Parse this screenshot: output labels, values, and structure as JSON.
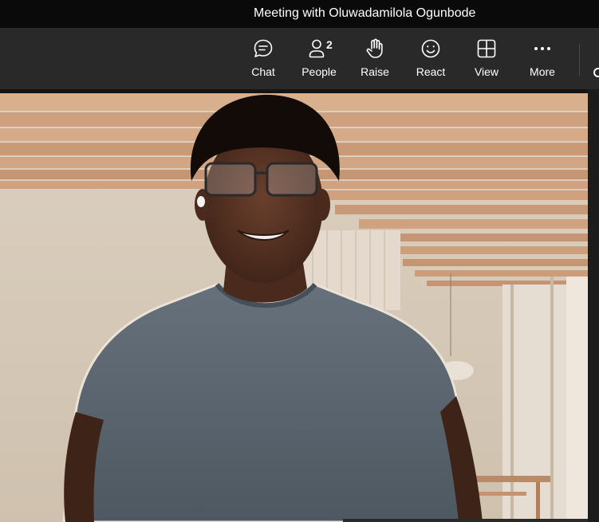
{
  "window": {
    "title": "Meeting with Oluwadamilola Ogunbode"
  },
  "toolbar": {
    "items": [
      {
        "label": "Chat",
        "icon": "chat-icon"
      },
      {
        "label": "People",
        "icon": "people-icon",
        "badge": "2"
      },
      {
        "label": "Raise",
        "icon": "raise-hand-icon"
      },
      {
        "label": "React",
        "icon": "react-emoji-icon"
      },
      {
        "label": "View",
        "icon": "view-grid-icon"
      },
      {
        "label": "More",
        "icon": "more-dots-icon"
      }
    ]
  },
  "colors": {
    "title_bar": "#0a0a0a",
    "toolbar": "#292929",
    "text": "#ffffff",
    "shirt": "#5b6670",
    "ceiling_wood": "#d2a785",
    "wall": "#d8cbbb"
  }
}
